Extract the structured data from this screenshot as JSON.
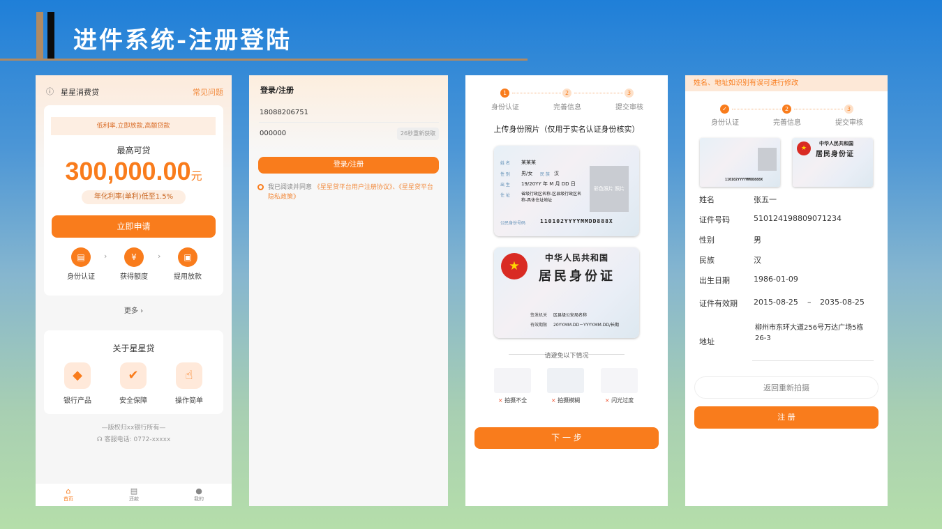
{
  "slide": {
    "title": "进件系统-注册登陆"
  },
  "p1": {
    "app_name": "星星消费贷",
    "faq": "常见问题",
    "promo": "低利率,立即放款,高额贷款",
    "max_label": "最高可贷",
    "amount": "300,000.00",
    "unit": "元",
    "rate": "年化利率(单利)低至1.5%",
    "apply": "立即申请",
    "flow": [
      "身份认证",
      "获得额度",
      "提用放款"
    ],
    "more": "更多",
    "about_title": "关于星星贷",
    "features": [
      "银行产品",
      "安全保障",
      "操作简单"
    ],
    "copyright": "—版权归xx银行所有—",
    "service": "客服电话: 0772-xxxxx",
    "nav": [
      "首页",
      "还款",
      "我的"
    ]
  },
  "p2": {
    "title": "登录/注册",
    "phone": "18088206751",
    "code": "000000",
    "resend": "26秒重新获取",
    "submit": "登录/注册",
    "agree_prefix": "我已阅读并同意",
    "agree_links": "《星星贷平台用户注册协议》、《星星贷平台隐私政策》"
  },
  "p3": {
    "steps": [
      "身份认证",
      "完善信息",
      "提交审核"
    ],
    "heading": "上传身份照片（仅用于实名认证身份核实）",
    "front": {
      "name_l": "姓 名",
      "name": "某某某",
      "sex_l": "性 别",
      "sex": "男/女",
      "nation_l": "民 族",
      "nation": "汉",
      "birth_l": "出 生",
      "y": "19/20YY",
      "m": "M",
      "d": "DD",
      "addr_l": "住 址",
      "addr": "省级行政区名称-区县级行政区名称-具体住址地址",
      "photo": "彩色照片 照片",
      "id_l": "公民身份号码",
      "id": "110102YYYYMMDD888X"
    },
    "back": {
      "country": "中华人民共和国",
      "doc": "居民身份证",
      "issuer_l": "签发机关",
      "issuer": "区县级公安局名称",
      "valid_l": "有效期限",
      "valid": "20YY.MM.DD－YYYY.MM.DD/长期"
    },
    "avoid": "请避免以下情况",
    "bad": [
      "拍摄不全",
      "拍摄模糊",
      "闪光过度"
    ],
    "next": "下 一 步"
  },
  "p4": {
    "notice": "姓名、地址如识别有误可进行修改",
    "steps": [
      "身份认证",
      "完善信息",
      "提交审核"
    ],
    "fields": [
      {
        "label": "姓名",
        "value": "张五一"
      },
      {
        "label": "证件号码",
        "value": "510124198809071234"
      },
      {
        "label": "性别",
        "value": "男"
      },
      {
        "label": "民族",
        "value": "汉"
      },
      {
        "label": "出生日期",
        "value": "1986-01-09"
      }
    ],
    "valid_label": "证件有效期",
    "valid_from": "2015-08-25",
    "valid_sep": "–",
    "valid_to": "2035-08-25",
    "addr_label": "地址",
    "addr": "柳州市东环大道256号万达广场5栋26-3",
    "retake": "返回重新拍摄",
    "submit": "注 册",
    "thumb_id": "110102YYYYMMDD888X",
    "thumb_country": "中华人民共和国",
    "thumb_doc": "居民身份证"
  },
  "colors": {
    "accent": "#f97c1c",
    "bg_top": "#1f7fd8",
    "bg_bottom": "#b5deaa"
  }
}
